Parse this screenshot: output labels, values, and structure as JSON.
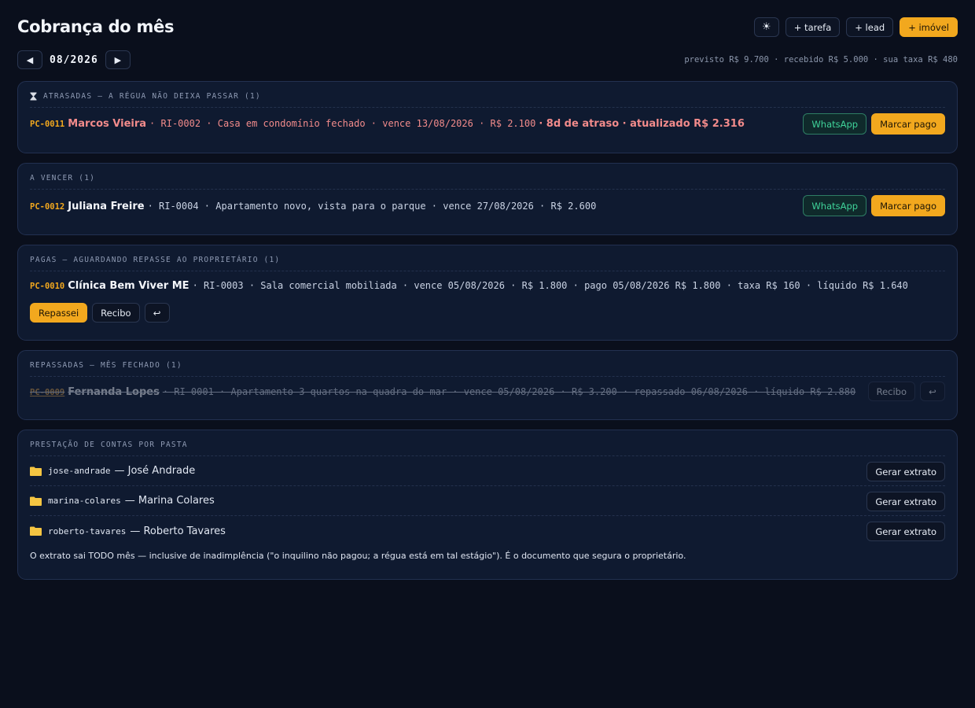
{
  "header": {
    "title": "Cobrança do mês",
    "theme_icon": "sun-icon",
    "theme_label": "☀",
    "add_task": "+ tarefa",
    "add_lead": "+ lead",
    "add_property": "+ imóvel"
  },
  "month": {
    "prev": "◀",
    "label": "08/2026",
    "next": "▶",
    "summary": "previsto R$ 9.700 · recebido R$ 5.000 · sua taxa R$ 480"
  },
  "sections": {
    "late": {
      "header": "ATRASADAS — A RÉGUA NÃO DEIXA PASSAR (1)",
      "icon": "hourglass-icon",
      "row": {
        "code": "PC-0011",
        "name": "Marcos Vieira",
        "meta": "· RI-0002 · Casa em condomínio fechado · vence 13/08/2026 · R$ 2.100",
        "alert": "· 8d de atraso · atualizado R$ 2.316",
        "whatsapp": "WhatsApp",
        "mark_paid": "Marcar pago"
      }
    },
    "due": {
      "header": "A VENCER (1)",
      "row": {
        "code": "PC-0012",
        "name": "Juliana Freire",
        "meta": "· RI-0004 · Apartamento novo, vista para o parque · vence 27/08/2026 · R$ 2.600",
        "whatsapp": "WhatsApp",
        "mark_paid": "Marcar pago"
      }
    },
    "paid": {
      "header": "PAGAS — AGUARDANDO REPASSE AO PROPRIETÁRIO (1)",
      "row": {
        "code": "PC-0010",
        "name": "Clínica Bem Viver ME",
        "meta": "· RI-0003 · Sala comercial mobiliada · vence 05/08/2026 · R$ 1.800 · pago 05/08/2026 R$ 1.800 · taxa R$ 160 · líquido R$ 1.640",
        "repassei": "Repassei",
        "recibo": "Recibo",
        "undo": "↩"
      }
    },
    "transferred": {
      "header": "REPASSADAS — MÊS FECHADO (1)",
      "row": {
        "code": "PC-0009",
        "name": "Fernanda Lopes",
        "meta": "· RI-0001 · Apartamento 3 quartos na quadra do mar · vence 05/08/2026 · R$ 3.200 · repassado 06/08/2026 · líquido R$ 2.880",
        "recibo": "Recibo",
        "undo": "↩"
      }
    },
    "statements": {
      "header": "PRESTAÇÃO DE CONTAS POR PASTA",
      "folders": [
        {
          "slug": "jose-andrade",
          "owner": "— José Andrade",
          "action": "Gerar extrato"
        },
        {
          "slug": "marina-colares",
          "owner": "— Marina Colares",
          "action": "Gerar extrato"
        },
        {
          "slug": "roberto-tavares",
          "owner": "— Roberto Tavares",
          "action": "Gerar extrato"
        }
      ],
      "note": "O extrato sai TODO mês — inclusive de inadimplência (\"o inquilino não pagou; a régua está em tal estágio\"). É o documento que segura o proprietário."
    }
  },
  "colors": {
    "accent": "#f2a81e",
    "late": "#f28b8b",
    "whatsapp": "#3fd49a",
    "folder": "#f5c542"
  }
}
